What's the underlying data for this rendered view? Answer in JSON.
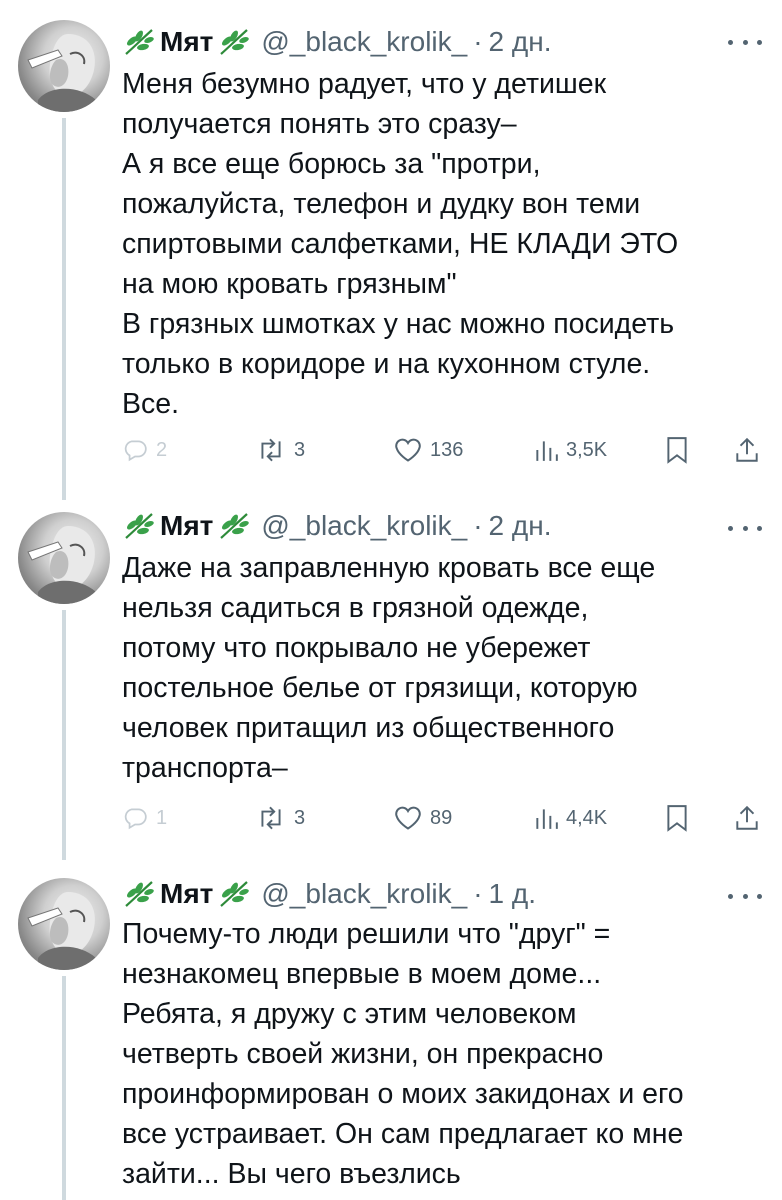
{
  "tweets": [
    {
      "name": "Мят",
      "handle": "@_black_krolik_",
      "separator": "·",
      "time": "2 дн.",
      "text": "Меня безумно радует, что у детишек\nполучается понять это сразу–\nА я все еще борюсь за \"протри,\nпожалуйста, телефон и дудку вон теми\nспиртовыми салфетками, НЕ КЛАДИ ЭТО\nна мою кровать грязным\"\nВ грязных шмотках у нас можно посидеть\nтолько в коридоре и на кухонном стуле.\nВсе.",
      "replies": "2",
      "retweets": "3",
      "likes": "136",
      "views": "3,5K"
    },
    {
      "name": "Мят",
      "handle": "@_black_krolik_",
      "separator": "·",
      "time": "2 дн.",
      "text": "Даже на заправленную кровать все еще\nнельзя садиться в грязной одежде,\nпотому что покрывало не убережет\nпостельное белье от грязищи, которую\nчеловек притащил из общественного\nтранспорта–",
      "replies": "1",
      "retweets": "3",
      "likes": "89",
      "views": "4,4K"
    },
    {
      "name": "Мят",
      "handle": "@_black_krolik_",
      "separator": "·",
      "time": "1 д.",
      "text": "Почему-то люди решили что \"друг\" =\nнезнакомец впервые в моем доме...\nРебята, я дружу с этим человеком\nчетверть своей жизни, он прекрасно\nпроинформирован о моих закидонах и его\nвсе устраивает. Он сам предлагает ко мне\nзайти... Вы чего въезлись"
    }
  ],
  "icons": {
    "name_decoration": "herb-icon",
    "reply": "reply-icon",
    "retweet": "retweet-icon",
    "like": "heart-icon",
    "views": "views-icon",
    "bookmark": "bookmark-icon",
    "share": "share-icon",
    "more": "more-icon"
  },
  "colors": {
    "text": "#0f1419",
    "secondary": "#536471",
    "thread_line": "#cfd9de",
    "leaf": "#2e8b3a"
  }
}
